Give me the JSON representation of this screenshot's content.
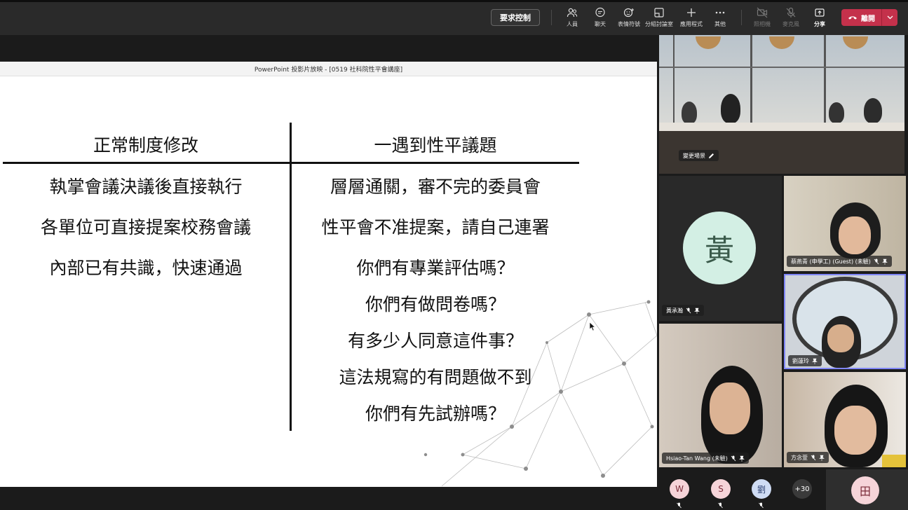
{
  "toolbar": {
    "request_control": "要求控制",
    "items": [
      {
        "label": "人員",
        "icon": "people-icon"
      },
      {
        "label": "聊天",
        "icon": "chat-icon"
      },
      {
        "label": "表情符號",
        "icon": "reactions-icon"
      },
      {
        "label": "分組討論室",
        "icon": "breakout-rooms-icon"
      },
      {
        "label": "應用程式",
        "icon": "apps-icon"
      },
      {
        "label": "其他",
        "icon": "more-icon"
      },
      {
        "label": "照相機",
        "icon": "camera-off-icon"
      },
      {
        "label": "麥克風",
        "icon": "mic-off-icon"
      },
      {
        "label": "分享",
        "icon": "share-icon"
      }
    ],
    "leave": "離開"
  },
  "slide": {
    "window_title": "PowerPoint 投影片放映 - [0519 社科院性平會講座]",
    "left_header": "正常制度修改",
    "right_header": "一遇到性平議題",
    "left_rows": [
      "執掌會議決議後直接執行",
      "各單位可直接提案校務會議",
      "內部已有共識，快速通過"
    ],
    "right_rows": [
      "層層通關，審不完的委員會",
      "性平會不准提案，請自己連署",
      "你們有專業評估嗎？",
      "你們有做問卷嗎？",
      "有多少人同意這件事？",
      "這法規寫的有問題做不到",
      "你們有先試辦嗎？"
    ]
  },
  "gallery": {
    "room_tile_name": "變更場景",
    "huang_initial": "黃",
    "huang_name": "黃承瀚",
    "p1_name": "蔡燕青 (申學工) (Guest) (未驗)",
    "p2_name": "劉蓮玲",
    "p3_name": "Hsiao-Tan Wang (未驗)",
    "p4_name": "方念萱",
    "overflow": [
      {
        "initial": "W",
        "color": "#f6d4d9",
        "text_color": "#7a2b38"
      },
      {
        "initial": "S",
        "color": "#f6d4d9",
        "text_color": "#7a2b38"
      },
      {
        "initial": "劉",
        "color": "#cfdcf4",
        "text_color": "#2b3f70"
      }
    ],
    "more_count": "+30",
    "extra_initial": "田"
  }
}
